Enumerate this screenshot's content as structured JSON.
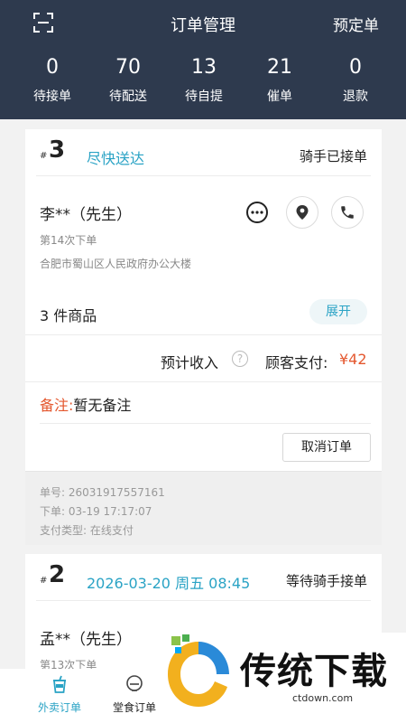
{
  "header": {
    "title": "订单管理",
    "reserve_label": "预定单",
    "stats": [
      {
        "num": "0",
        "label": "待接单"
      },
      {
        "num": "70",
        "label": "待配送"
      },
      {
        "num": "13",
        "label": "待自提"
      },
      {
        "num": "21",
        "label": "催单"
      },
      {
        "num": "0",
        "label": "退款"
      }
    ]
  },
  "order1": {
    "hash": "#",
    "number": "3",
    "tag": "尽快送达",
    "status": "骑手已接单",
    "customer_name": "李**（先生）",
    "order_count": "第14次下单",
    "address": "合肥市蜀山区人民政府办公大楼",
    "goods": "3 件商品",
    "expand_label": "展开",
    "income_label": "预计收入",
    "help": "?",
    "pay_label": "顾客支付:",
    "pay_amount": "¥42",
    "remark_key": "备注:",
    "remark_value": "暂无备注",
    "cancel_label": "取消订单",
    "order_id": "单号: 26031917557161",
    "order_time": "下单: 03-19 17:17:07",
    "pay_type": "支付类型: 在线支付"
  },
  "order2": {
    "hash": "#",
    "number": "2",
    "tag": "2026-03-20 周五 08:45",
    "status": "等待骑手接单",
    "customer_name": "孟**（先生）",
    "order_count": "第13次下单"
  },
  "tabbar": {
    "tabs": [
      {
        "label": "外卖订单"
      },
      {
        "label": "堂食订单"
      }
    ]
  },
  "watermark": {
    "title": "传统下载",
    "domain": "ctdown.com"
  },
  "colors": {
    "header_bg": "#2e3a4e",
    "accent": "#2aa3c5",
    "price": "#e4572e"
  }
}
